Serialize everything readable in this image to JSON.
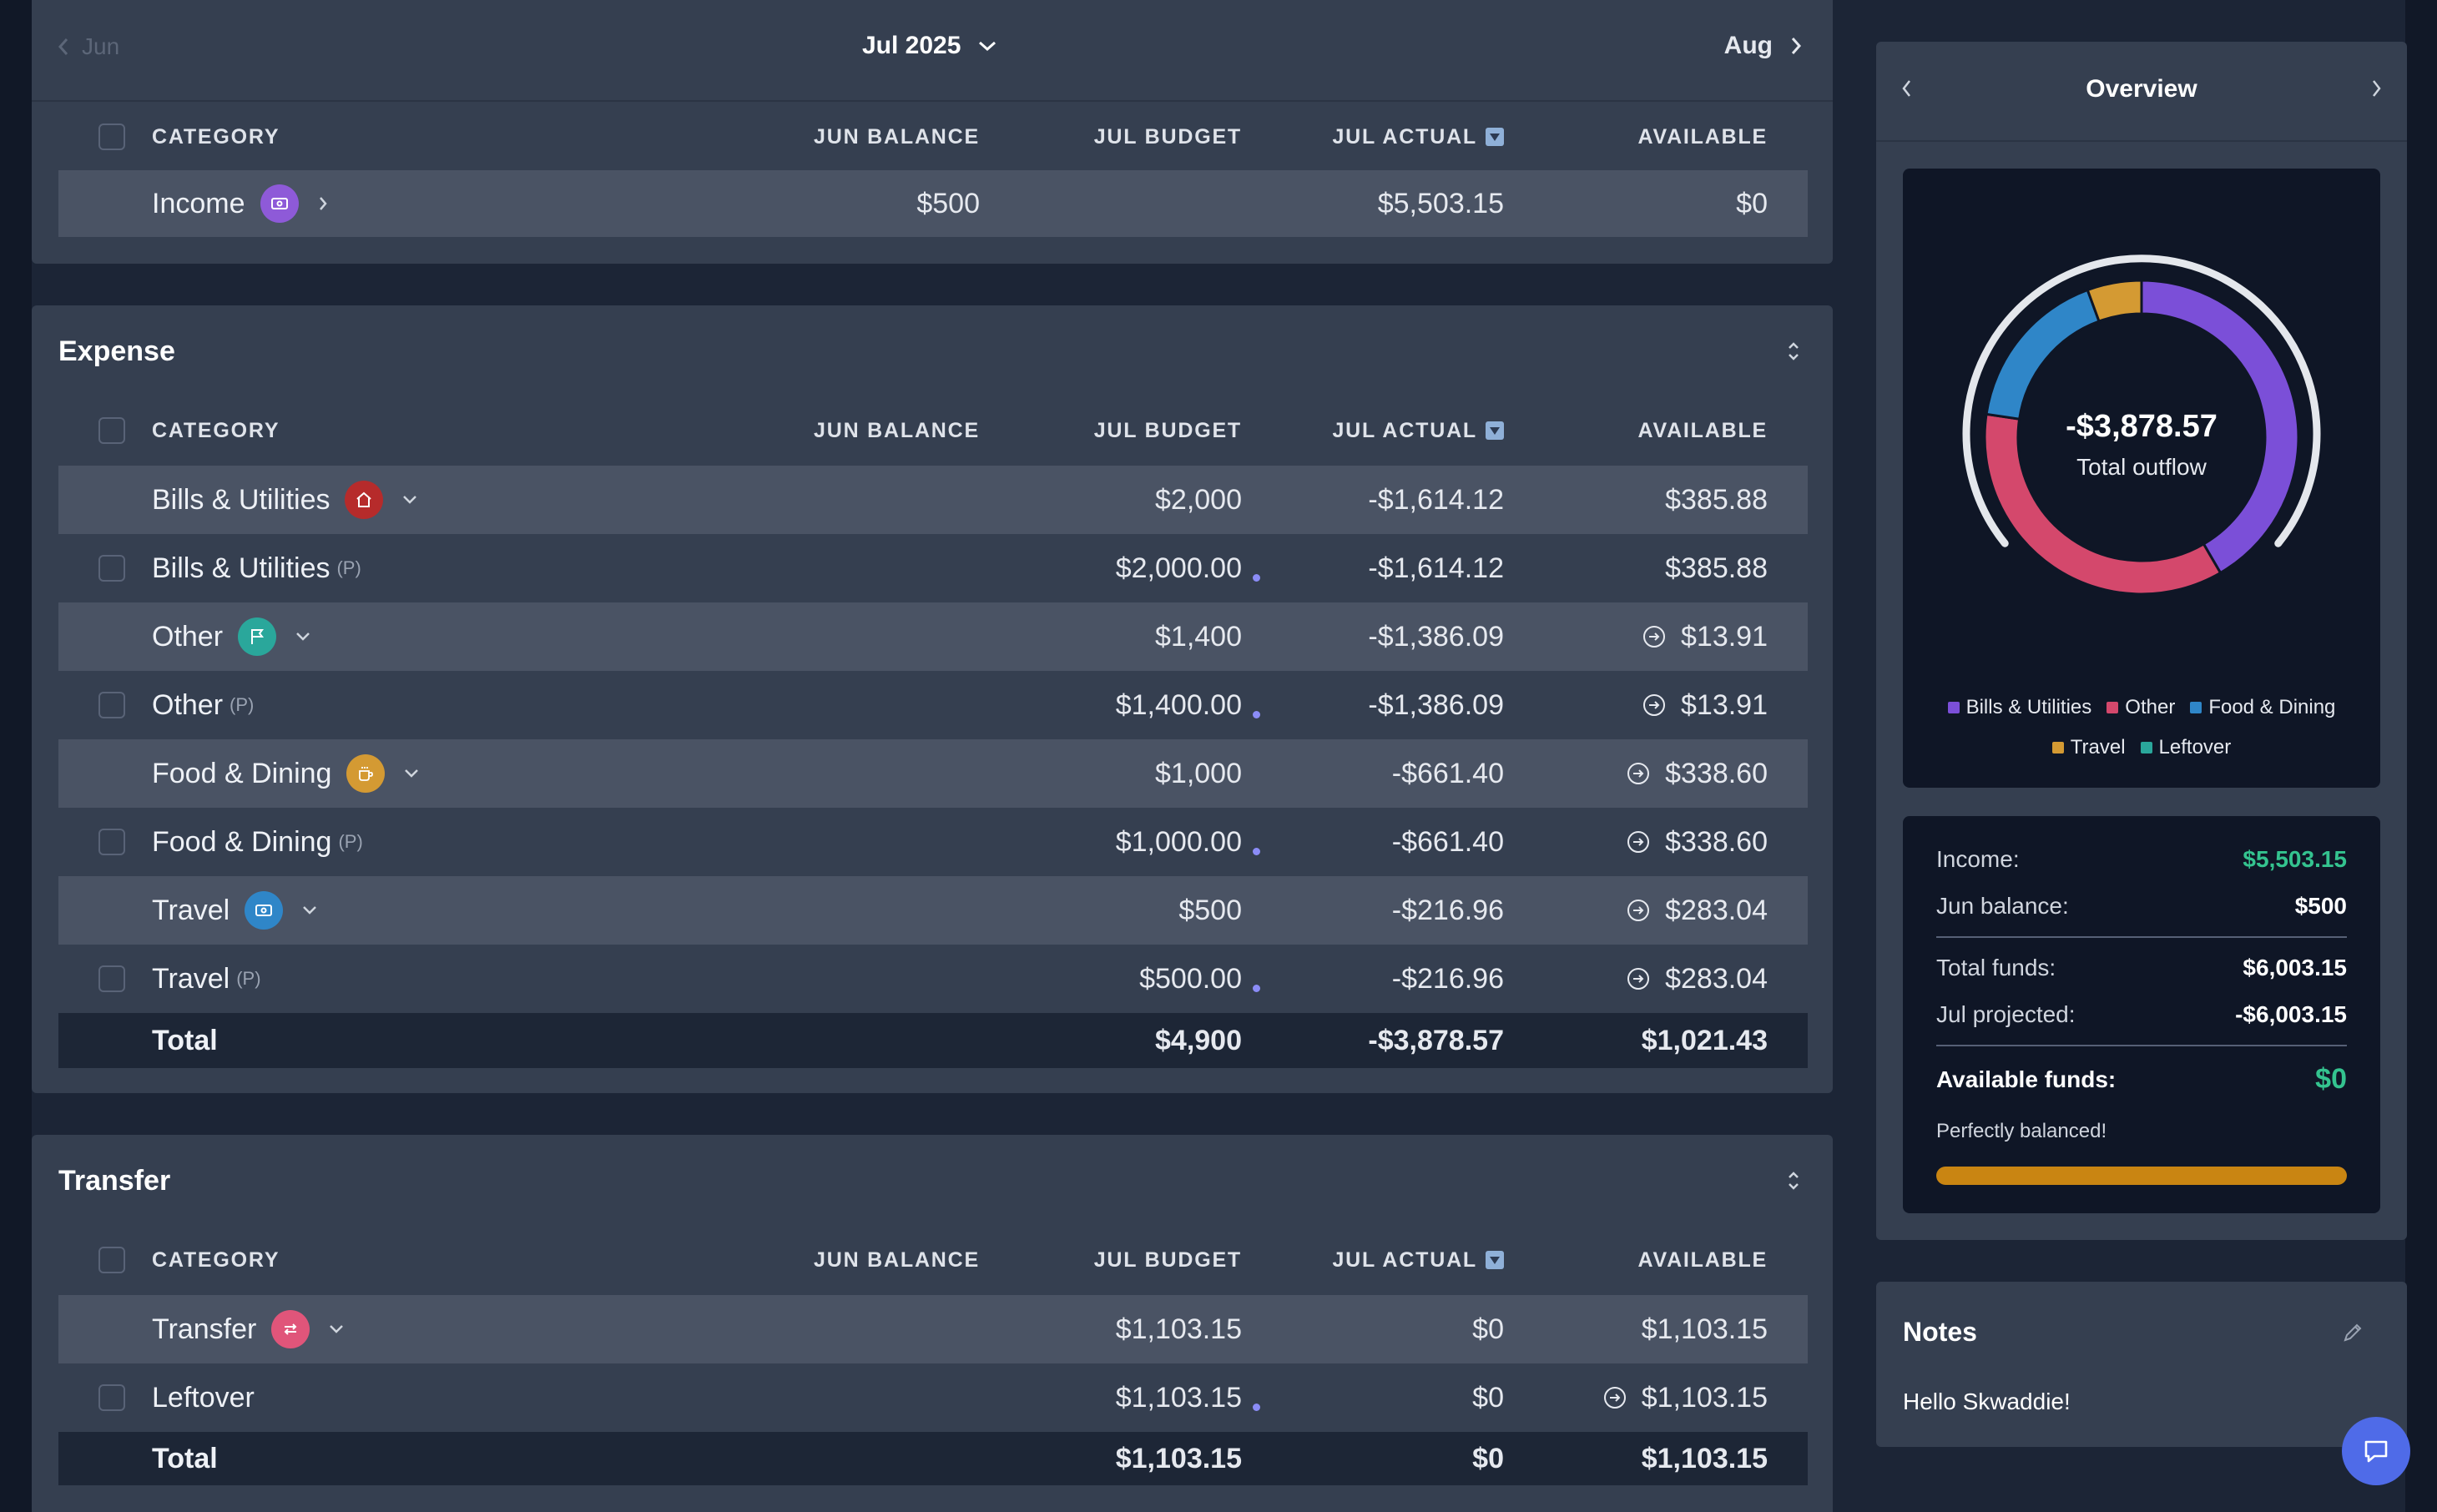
{
  "month_nav": {
    "prev": "Jun",
    "current": "Jul 2025",
    "next": "Aug"
  },
  "columns": {
    "category": "CATEGORY",
    "jun_balance": "JUN BALANCE",
    "jul_budget": "JUL BUDGET",
    "jul_actual": "JUL ACTUAL",
    "available": "AVAILABLE"
  },
  "income": {
    "row": {
      "name": "Income",
      "jun_balance": "$500",
      "jul_budget": "",
      "jul_actual": "$5,503.15",
      "available": "$0"
    }
  },
  "expense": {
    "title": "Expense",
    "rows": [
      {
        "name": "Bills & Utilities",
        "budget": "$2,000",
        "actual": "-$1,614.12",
        "available": "$385.88"
      },
      {
        "name": "Bills & Utilities",
        "tag": "(P)",
        "budget": "$2,000.00",
        "actual": "-$1,614.12",
        "available": "$385.88"
      },
      {
        "name": "Other",
        "budget": "$1,400",
        "actual": "-$1,386.09",
        "available": "$13.91"
      },
      {
        "name": "Other",
        "tag": "(P)",
        "budget": "$1,400.00",
        "actual": "-$1,386.09",
        "available": "$13.91"
      },
      {
        "name": "Food & Dining",
        "budget": "$1,000",
        "actual": "-$661.40",
        "available": "$338.60"
      },
      {
        "name": "Food & Dining",
        "tag": "(P)",
        "budget": "$1,000.00",
        "actual": "-$661.40",
        "available": "$338.60"
      },
      {
        "name": "Travel",
        "budget": "$500",
        "actual": "-$216.96",
        "available": "$283.04"
      },
      {
        "name": "Travel",
        "tag": "(P)",
        "budget": "$500.00",
        "actual": "-$216.96",
        "available": "$283.04"
      }
    ],
    "total": {
      "label": "Total",
      "budget": "$4,900",
      "actual": "-$3,878.57",
      "available": "$1,021.43"
    }
  },
  "transfer": {
    "title": "Transfer",
    "rows": [
      {
        "name": "Transfer",
        "budget": "$1,103.15",
        "actual": "$0",
        "available": "$1,103.15"
      },
      {
        "name": "Leftover",
        "budget": "$1,103.15",
        "actual": "$0",
        "available": "$1,103.15"
      }
    ],
    "total": {
      "label": "Total",
      "budget": "$1,103.15",
      "actual": "$0",
      "available": "$1,103.15"
    }
  },
  "overview": {
    "title": "Overview",
    "donut": {
      "amount": "-$3,878.57",
      "label": "Total outflow",
      "segments": [
        {
          "name": "Bills & Utilities",
          "value": 1614.12,
          "color": "#7b4fd8"
        },
        {
          "name": "Other",
          "value": 1386.09,
          "color": "#d4486c"
        },
        {
          "name": "Food & Dining",
          "value": 661.4,
          "color": "#2f86c8"
        },
        {
          "name": "Travel",
          "value": 216.96,
          "color": "#d49a33"
        }
      ]
    },
    "legend": [
      {
        "name": "Bills & Utilities",
        "color": "#7b4fd8"
      },
      {
        "name": "Other",
        "color": "#d4486c"
      },
      {
        "name": "Food & Dining",
        "color": "#2f86c8"
      },
      {
        "name": "Travel",
        "color": "#d49a33"
      },
      {
        "name": "Leftover",
        "color": "#2aa79b"
      }
    ]
  },
  "summary": {
    "income_label": "Income:",
    "income_value": "$5,503.15",
    "jun_balance_label": "Jun balance:",
    "jun_balance_value": "$500",
    "total_funds_label": "Total funds:",
    "total_funds_value": "$6,003.15",
    "jul_projected_label": "Jul projected:",
    "jul_projected_value": "-$6,003.15",
    "available_label": "Available funds:",
    "available_value": "$0",
    "status": "Perfectly balanced!",
    "progress": 1.0
  },
  "notes": {
    "title": "Notes",
    "text": "Hello Skwaddie!"
  },
  "colors": {
    "accent_green": "#34c38f",
    "progress": "#c98512",
    "chat": "#4f6be8"
  }
}
